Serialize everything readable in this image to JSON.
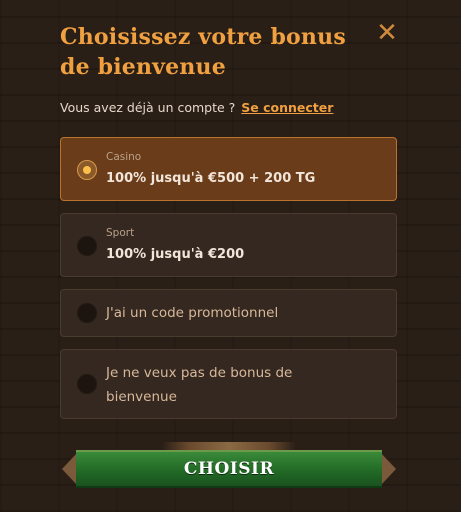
{
  "header": {
    "title": "Choisissez votre bonus de bienvenue",
    "close_glyph": "✕"
  },
  "login": {
    "prompt": "Vous avez déjà un compte ?",
    "link": "Se connecter"
  },
  "options": [
    {
      "category": "Casino",
      "label": "100% jusqu'à €500 + 200 TG",
      "selected": true
    },
    {
      "category": "Sport",
      "label": "100% jusqu'à €200",
      "selected": false
    },
    {
      "category": "",
      "label": "J'ai un code promotionnel",
      "selected": false
    },
    {
      "category": "",
      "label": "Je ne veux pas de bonus de bienvenue",
      "selected": false
    }
  ],
  "actions": {
    "choose_label": "CHOISIR"
  },
  "colors": {
    "accent": "#f0a040",
    "selected_bg": "#6a3c1a",
    "button_green": "#226a26"
  }
}
